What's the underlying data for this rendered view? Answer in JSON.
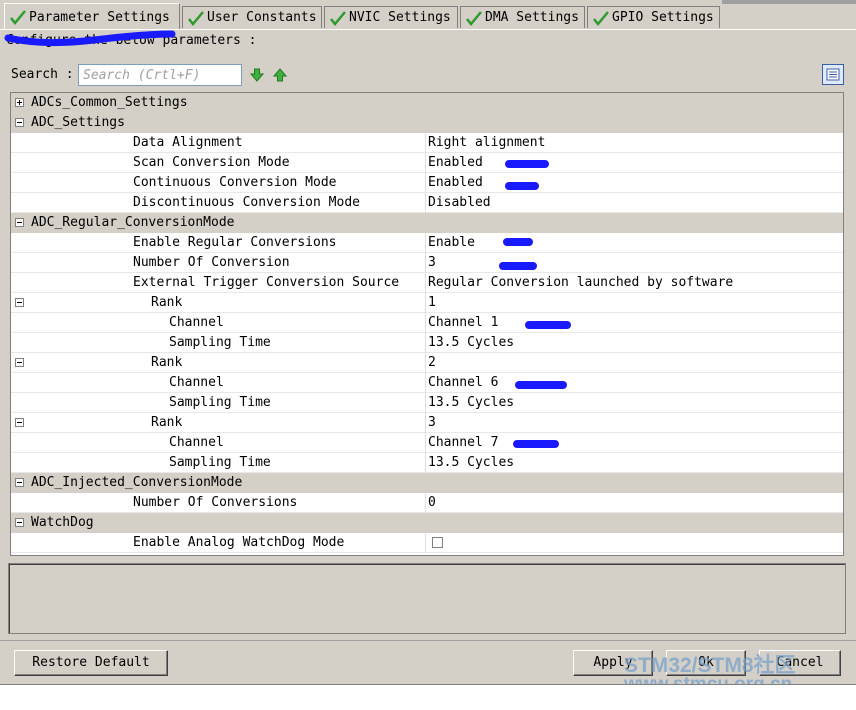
{
  "tabs": [
    {
      "label": "Parameter Settings",
      "active": true
    },
    {
      "label": "User Constants",
      "active": false
    },
    {
      "label": "NVIC Settings",
      "active": false
    },
    {
      "label": "DMA Settings",
      "active": false
    },
    {
      "label": "GPIO Settings",
      "active": false
    }
  ],
  "configure_text": "Configure the below parameters :",
  "search": {
    "label": "Search :",
    "placeholder": "Search (Crtl+F)"
  },
  "table": {
    "groups": {
      "adcs_common": "ADCs_Common_Settings",
      "adc_settings": "ADC_Settings",
      "regular": "ADC_Regular_ConversionMode",
      "injected": "ADC_Injected_ConversionMode",
      "watchdog": "WatchDog"
    },
    "params": {
      "data_alignment": {
        "name": "Data Alignment",
        "value": "Right alignment"
      },
      "scan_mode": {
        "name": "Scan Conversion Mode",
        "value": "Enabled"
      },
      "continuous_mode": {
        "name": "Continuous Conversion Mode",
        "value": "Enabled"
      },
      "discontinuous_mode": {
        "name": "Discontinuous Conversion Mode",
        "value": "Disabled"
      },
      "enable_regular": {
        "name": "Enable Regular Conversions",
        "value": "Enable"
      },
      "number_of_conversion": {
        "name": "Number Of Conversion",
        "value": "3"
      },
      "external_trigger": {
        "name": "External Trigger Conversion Source",
        "value": "Regular Conversion launched by software"
      },
      "rank1": {
        "name": "Rank",
        "value": "1"
      },
      "rank1_channel": {
        "name": "Channel",
        "value": "Channel 1"
      },
      "rank1_sampling": {
        "name": "Sampling Time",
        "value": "13.5 Cycles"
      },
      "rank2": {
        "name": "Rank",
        "value": "2"
      },
      "rank2_channel": {
        "name": "Channel",
        "value": "Channel 6"
      },
      "rank2_sampling": {
        "name": "Sampling Time",
        "value": "13.5 Cycles"
      },
      "rank3": {
        "name": "Rank",
        "value": "3"
      },
      "rank3_channel": {
        "name": "Channel",
        "value": "Channel 7"
      },
      "rank3_sampling": {
        "name": "Sampling Time",
        "value": "13.5 Cycles"
      },
      "injected_conversions": {
        "name": "Number Of Conversions",
        "value": "0"
      },
      "analog_watchdog": {
        "name": "Enable Analog WatchDog Mode",
        "checked": false
      }
    }
  },
  "buttons": {
    "restore": "Restore Default",
    "apply": "Apply",
    "ok": "Ok",
    "cancel": "Cancel"
  },
  "watermark": {
    "line1": "STM32/STM8社区",
    "line2": "www.stmcu.org.cn"
  },
  "colors": {
    "window_bg": "#d4d0c8",
    "check_green": "#2e9b2e",
    "scribble_blue": "#1a1aff"
  }
}
